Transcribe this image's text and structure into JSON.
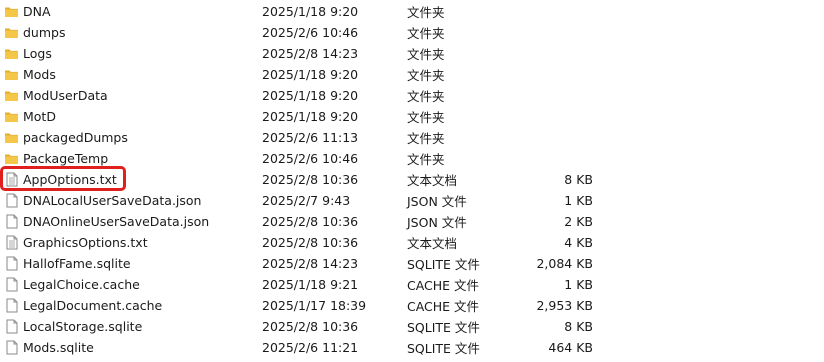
{
  "files": [
    {
      "name": "DNA",
      "date": "2025/1/18 9:20",
      "type": "文件夹",
      "size": "",
      "kind": "folder-icon"
    },
    {
      "name": "dumps",
      "date": "2025/2/6 10:46",
      "type": "文件夹",
      "size": "",
      "kind": "folder-icon"
    },
    {
      "name": "Logs",
      "date": "2025/2/8 14:23",
      "type": "文件夹",
      "size": "",
      "kind": "folder-icon"
    },
    {
      "name": "Mods",
      "date": "2025/1/18 9:20",
      "type": "文件夹",
      "size": "",
      "kind": "folder-icon"
    },
    {
      "name": "ModUserData",
      "date": "2025/1/18 9:20",
      "type": "文件夹",
      "size": "",
      "kind": "folder-icon"
    },
    {
      "name": "MotD",
      "date": "2025/1/18 9:20",
      "type": "文件夹",
      "size": "",
      "kind": "folder-icon"
    },
    {
      "name": "packagedDumps",
      "date": "2025/2/6 11:13",
      "type": "文件夹",
      "size": "",
      "kind": "folder-icon"
    },
    {
      "name": "PackageTemp",
      "date": "2025/2/6 10:46",
      "type": "文件夹",
      "size": "",
      "kind": "folder-icon"
    },
    {
      "name": "AppOptions.txt",
      "date": "2025/2/8 10:36",
      "type": "文本文档",
      "size": "8 KB",
      "kind": "text-file-icon"
    },
    {
      "name": "DNALocalUserSaveData.json",
      "date": "2025/2/7 9:43",
      "type": "JSON 文件",
      "size": "1 KB",
      "kind": "file-icon"
    },
    {
      "name": "DNAOnlineUserSaveData.json",
      "date": "2025/2/8 10:36",
      "type": "JSON 文件",
      "size": "2 KB",
      "kind": "file-icon"
    },
    {
      "name": "GraphicsOptions.txt",
      "date": "2025/2/8 10:36",
      "type": "文本文档",
      "size": "4 KB",
      "kind": "text-file-icon"
    },
    {
      "name": "HallofFame.sqlite",
      "date": "2025/2/8 14:23",
      "type": "SQLITE 文件",
      "size": "2,084 KB",
      "kind": "file-icon"
    },
    {
      "name": "LegalChoice.cache",
      "date": "2025/1/18 9:21",
      "type": "CACHE 文件",
      "size": "1 KB",
      "kind": "file-icon"
    },
    {
      "name": "LegalDocument.cache",
      "date": "2025/1/17 18:39",
      "type": "CACHE 文件",
      "size": "2,953 KB",
      "kind": "file-icon"
    },
    {
      "name": "LocalStorage.sqlite",
      "date": "2025/2/8 10:36",
      "type": "SQLITE 文件",
      "size": "8 KB",
      "kind": "file-icon"
    },
    {
      "name": "Mods.sqlite",
      "date": "2025/2/6 11:21",
      "type": "SQLITE 文件",
      "size": "464 KB",
      "kind": "file-icon"
    }
  ],
  "highlighted_file": "AppOptions.txt",
  "colors": {
    "folder": "#f5c749",
    "folder_dark": "#e4ad2a",
    "highlight": "#e0201c",
    "file_border": "#8a8a8a"
  }
}
